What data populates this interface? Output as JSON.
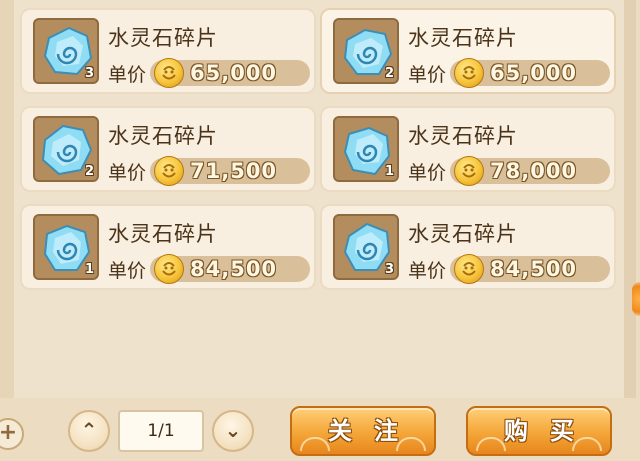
{
  "market": {
    "price_label": "单价",
    "items": [
      {
        "name": "水灵石碎片",
        "qty": "3",
        "price": "65,000"
      },
      {
        "name": "水灵石碎片",
        "qty": "2",
        "price": "65,000"
      },
      {
        "name": "水灵石碎片",
        "qty": "2",
        "price": "71,500"
      },
      {
        "name": "水灵石碎片",
        "qty": "1",
        "price": "78,000"
      },
      {
        "name": "水灵石碎片",
        "qty": "1",
        "price": "84,500"
      },
      {
        "name": "水灵石碎片",
        "qty": "3",
        "price": "84,500"
      }
    ]
  },
  "pager": {
    "page": "1/1",
    "up_icon": "chevron-up-icon",
    "down_icon": "chevron-down-icon"
  },
  "actions": {
    "follow_label": "关注",
    "buy_label": "购买",
    "add_icon": "plus-icon"
  },
  "colors": {
    "panel_bg": "#efe2cc",
    "card_bg": "#f8efe1",
    "price_bar": "#d9c09a",
    "button_orange": "#f5a93c",
    "crystal": "#7fd3f2"
  }
}
